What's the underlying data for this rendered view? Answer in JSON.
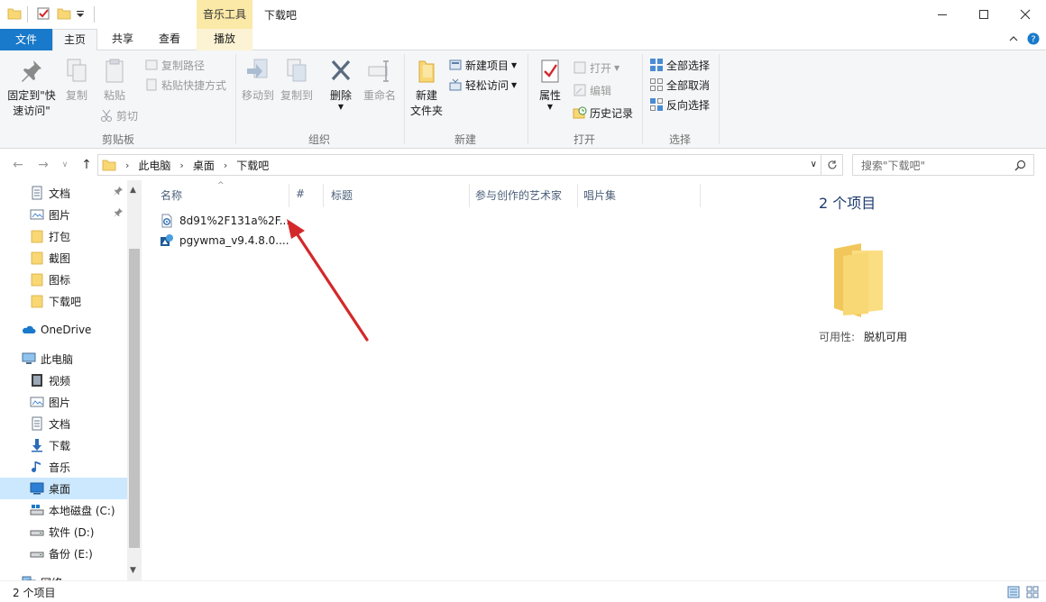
{
  "titlebar": {
    "context_tab": "音乐工具",
    "window_title": "下载吧"
  },
  "tabs": {
    "file": "文件",
    "home": "主页",
    "share": "共享",
    "view": "查看",
    "play": "播放"
  },
  "ribbon": {
    "clipboard": {
      "pin_quick_access_1": "固定到\"快",
      "pin_quick_access_2": "速访问\"",
      "copy": "复制",
      "paste": "粘贴",
      "copy_path": "复制路径",
      "paste_shortcut": "粘贴快捷方式",
      "cut": "剪切",
      "label": "剪贴板"
    },
    "organize": {
      "move_to": "移动到",
      "copy_to": "复制到",
      "delete": "删除",
      "rename": "重命名",
      "label": "组织"
    },
    "new": {
      "new_folder_1": "新建",
      "new_folder_2": "文件夹",
      "new_item": "新建项目",
      "easy_access": "轻松访问",
      "label": "新建"
    },
    "open": {
      "properties": "属性",
      "open": "打开",
      "edit": "编辑",
      "history": "历史记录",
      "label": "打开"
    },
    "select": {
      "select_all": "全部选择",
      "select_none": "全部取消",
      "invert": "反向选择",
      "label": "选择"
    }
  },
  "address": {
    "crumbs": [
      "此电脑",
      "桌面",
      "下载吧"
    ],
    "search_placeholder": "搜索\"下载吧\""
  },
  "nav": {
    "items": [
      {
        "label": "文档",
        "icon": "document-icon",
        "pinned": true
      },
      {
        "label": "图片",
        "icon": "picture-icon",
        "pinned": true
      },
      {
        "label": "打包",
        "icon": "folder-icon"
      },
      {
        "label": "截图",
        "icon": "folder-icon"
      },
      {
        "label": "图标",
        "icon": "folder-icon"
      },
      {
        "label": "下载吧",
        "icon": "folder-icon"
      },
      {
        "label": "OneDrive",
        "icon": "onedrive-icon"
      },
      {
        "label": "此电脑",
        "icon": "computer-icon"
      },
      {
        "label": "视频",
        "icon": "video-icon"
      },
      {
        "label": "图片",
        "icon": "picture-icon"
      },
      {
        "label": "文档",
        "icon": "document-icon"
      },
      {
        "label": "下载",
        "icon": "download-icon"
      },
      {
        "label": "音乐",
        "icon": "music-icon"
      },
      {
        "label": "桌面",
        "icon": "desktop-icon",
        "selected": true
      },
      {
        "label": "本地磁盘 (C:)",
        "icon": "drive-icon"
      },
      {
        "label": "软件 (D:)",
        "icon": "drive-icon"
      },
      {
        "label": "备份 (E:)",
        "icon": "drive-icon"
      },
      {
        "label": "网络",
        "icon": "network-icon"
      }
    ]
  },
  "columns": {
    "name": "名称",
    "number": "#",
    "title": "标题",
    "artist": "参与创作的艺术家",
    "album": "唱片集"
  },
  "files": [
    {
      "name": "8d91%2F131a%2F...",
      "icon": "media-file-icon"
    },
    {
      "name": "pgywma_v9.4.8.0....",
      "icon": "app-icon"
    }
  ],
  "details": {
    "count": "2 个项目",
    "availability_label": "可用性:",
    "availability_value": "脱机可用"
  },
  "status": {
    "count": "2 个项目"
  },
  "colors": {
    "accent": "#1979ca",
    "context_tab": "#fbe9a8",
    "selection": "#cce8ff",
    "folder": "#f8d775",
    "arrow": "#d4282a"
  }
}
